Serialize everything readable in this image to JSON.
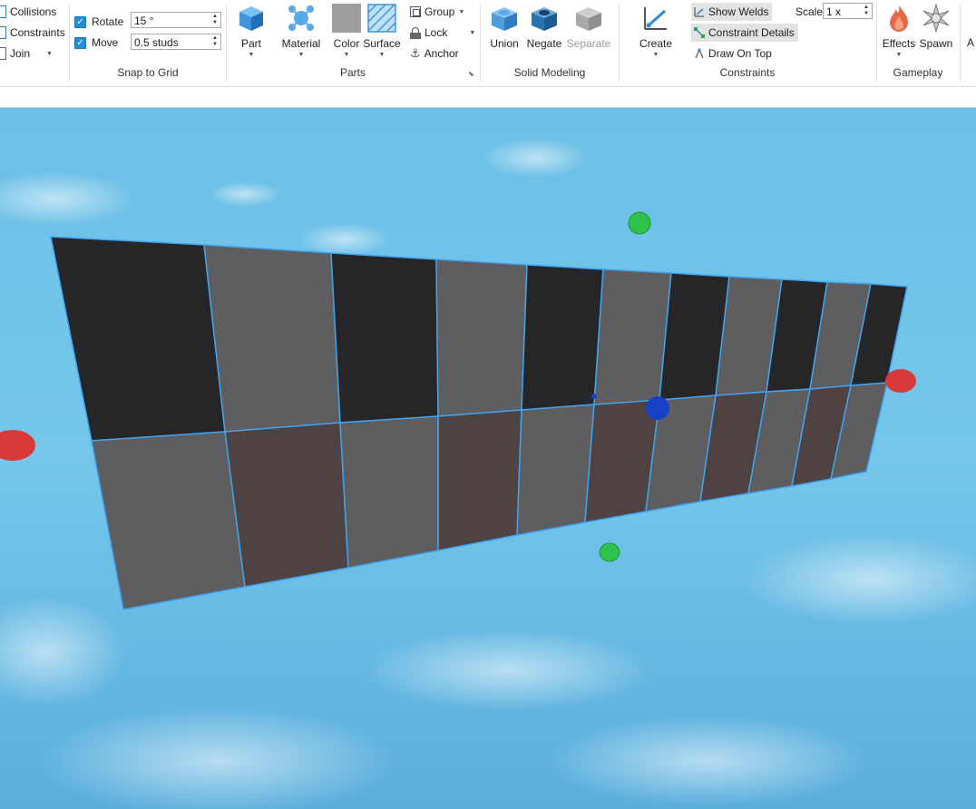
{
  "ribbon": {
    "left_group": {
      "collisions": "Collisions",
      "constraints": "Constraints",
      "join": "Join"
    },
    "snap_to_grid": {
      "label": "Snap to Grid",
      "rotate_label": "Rotate",
      "rotate_value": "15 °",
      "move_label": "Move",
      "move_value": "0.5 studs"
    },
    "parts": {
      "label": "Parts",
      "part": "Part",
      "material": "Material",
      "color": "Color",
      "surface": "Surface",
      "group": "Group",
      "lock": "Lock",
      "anchor": "Anchor"
    },
    "solid_modeling": {
      "label": "Solid Modeling",
      "union": "Union",
      "negate": "Negate",
      "separate": "Separate"
    },
    "constraints": {
      "label": "Constraints",
      "create": "Create",
      "show_welds": "Show Welds",
      "constraint_details": "Constraint Details",
      "draw_on_top": "Draw On Top",
      "scale_label": "Scale",
      "scale_value": "1 x"
    },
    "gameplay": {
      "label": "Gameplay",
      "effects": "Effects",
      "spawn": "Spawn",
      "partial": "A"
    }
  },
  "colors": {
    "accent": "#1f8fd6",
    "sky": "#6cbfe6",
    "dark_tile": "#262528",
    "gray_tile": "#5e5d60",
    "brown_tile": "#4f4243",
    "selection": "#3fa3f0",
    "handle_red": "#d83a3a",
    "handle_green": "#2ec24a",
    "handle_blue": "#1741c9"
  },
  "icons": {
    "collisions": "collisions-icon",
    "constraints": "constraints-icon",
    "join": "join-icon",
    "part": "part-cube-icon",
    "material": "material-icon",
    "color": "color-swatch-icon",
    "surface": "surface-icon",
    "group": "group-icon",
    "lock": "lock-icon",
    "anchor": "anchor-icon",
    "union": "union-icon",
    "negate": "negate-icon",
    "separate": "separate-icon",
    "create": "create-constraint-icon",
    "show_welds": "weld-icon",
    "constraint_details": "constraint-details-icon",
    "draw_on_top": "draw-on-top-icon",
    "effects": "fire-icon",
    "spawn": "spawn-icon"
  }
}
